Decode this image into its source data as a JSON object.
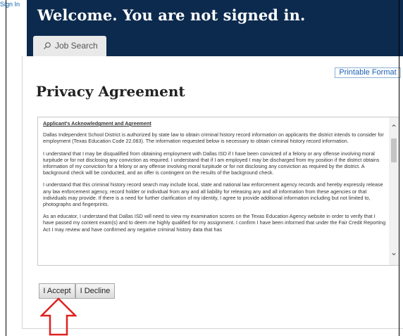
{
  "header": {
    "sign_in": "Sign In",
    "welcome": "Welcome. You are not signed in."
  },
  "tabs": {
    "job_search": "Job Search",
    "job_search_icon": "search-icon"
  },
  "toolbar": {
    "printable": "Printable Format"
  },
  "page": {
    "title": "Privacy Agreement"
  },
  "agreement": {
    "heading": "Applicant's Acknowledgment and Agreement",
    "paragraphs": [
      "Dallas Independent School District is authorized by state law to obtain criminal history record information on applicants the district intends to consider for employment (Texas Education Code 22.083). The information requested below is necessary to obtain criminal history record information.",
      "I understand that I may be disqualified from obtaining employment with Dallas ISD if I have been convicted of a felony or any offense involving moral turpitude or for not disclosing any conviction as required. I understand that if I am employed I may be discharged from my position if the district obtains information of my conviction for a felony or any offense involving moral turpitude or for not disclosing any conviction as required by the district. A background check will be conducted, and an offer is contingent on the results of the background check.",
      "I understand that this criminal history record search may include local, state and national law enforcement agency records and hereby expressly release any law enforcement agency, record holder or individual from any and all liability for releasing any and all information from these agencies or that individuals may provide. If there is a need for further clarification of my identity, I agree to provide additional information including but not limited to, photographs and fingerprints.",
      "As an educator, I understand that Dallas ISD will need to view my examination scores on the Texas Education Agency website in order to verify that I have passed my content exam(s) and to deem me highly qualified for my assignment. I confirm I have been informed that under the Fair Credit Reporting Act I may review and have confirmed any negative criminal history data that has"
    ]
  },
  "buttons": {
    "accept": "I Accept",
    "decline": "I Decline"
  },
  "colors": {
    "header_bg": "#0c2a4e",
    "link": "#1a5fb4",
    "annotation_arrow": "#e02020"
  }
}
